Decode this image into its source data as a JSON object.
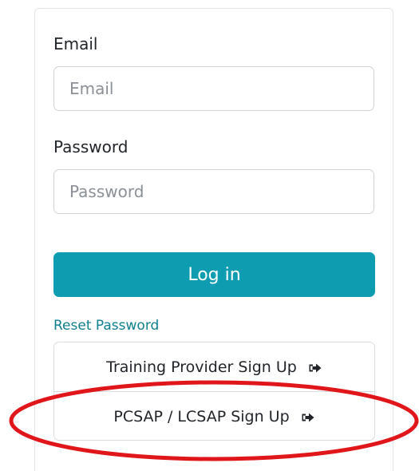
{
  "login_form": {
    "email_label": "Email",
    "email_placeholder": "Email",
    "email_value": "",
    "password_label": "Password",
    "password_placeholder": "Password",
    "password_value": "",
    "login_button": "Log in",
    "reset_password_link": "Reset Password"
  },
  "signup_options": [
    {
      "label": "Training Provider Sign Up",
      "icon": "sign-in-icon"
    },
    {
      "label": "PCSAP / LCSAP Sign Up",
      "icon": "sign-in-icon"
    }
  ],
  "colors": {
    "primary": "#0e9cb0",
    "link": "#0f7e8e",
    "highlight_ring": "#e0161b"
  }
}
